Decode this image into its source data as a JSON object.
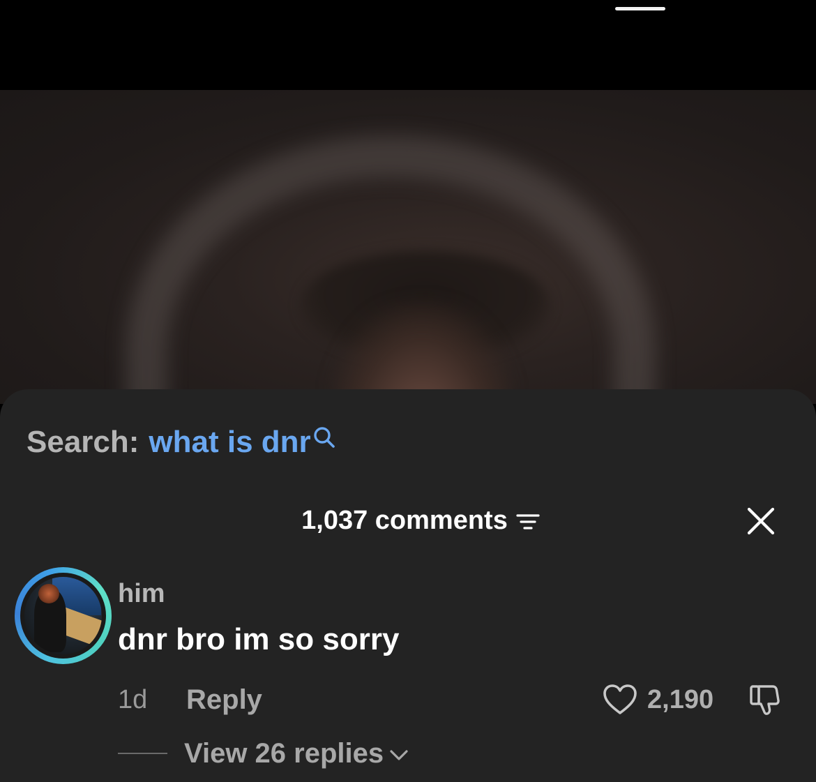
{
  "search": {
    "label": "Search:",
    "term": "what is dnr",
    "icon": "search-icon",
    "term_color": "#6aa7f0"
  },
  "comments": {
    "count_label": "1,037 comments",
    "filter_icon": "filter-icon",
    "close_icon": "close-icon"
  },
  "comment": {
    "username": "him",
    "text": "dnr bro im so sorry",
    "time": "1d",
    "reply_label": "Reply",
    "like_count": "2,190",
    "view_replies_label": "View 26 replies",
    "avatar_ring_colors": [
      "#3b82d8",
      "#5fe0c8"
    ]
  },
  "colors": {
    "sheet_background": "#232323",
    "accent_link": "#6aa7f0"
  }
}
